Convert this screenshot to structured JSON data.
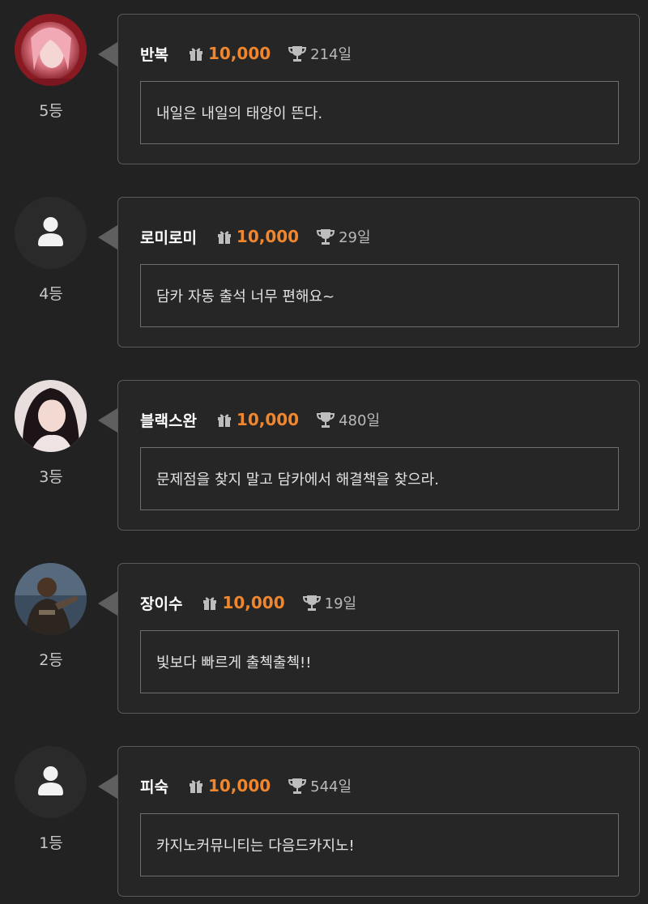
{
  "colors": {
    "background": "#222222",
    "points": "#f0862e",
    "name": "#ffffff"
  },
  "entries": [
    {
      "rank": "5등",
      "name": "반복",
      "points": "10,000",
      "days": "214일",
      "message": "내일은 내일의 태양이 뜬다.",
      "avatar": "photo-red-hair"
    },
    {
      "rank": "4등",
      "name": "로미로미",
      "points": "10,000",
      "days": "29일",
      "message": "담카 자동 출석 너무 편해요~",
      "avatar": "default-user-icon"
    },
    {
      "rank": "3등",
      "name": "블랙스완",
      "points": "10,000",
      "days": "480일",
      "message": "문제점을 찾지 말고 담카에서 해결책을 찾으라.",
      "avatar": "photo-dark-hair"
    },
    {
      "rank": "2등",
      "name": "장이수",
      "points": "10,000",
      "days": "19일",
      "message": "빛보다 빠르게 출첵출첵!!",
      "avatar": "photo-man-dark"
    },
    {
      "rank": "1등",
      "name": "피숙",
      "points": "10,000",
      "days": "544일",
      "message": "카지노커뮤니티는 다음드카지노!",
      "avatar": "default-user-icon"
    }
  ]
}
